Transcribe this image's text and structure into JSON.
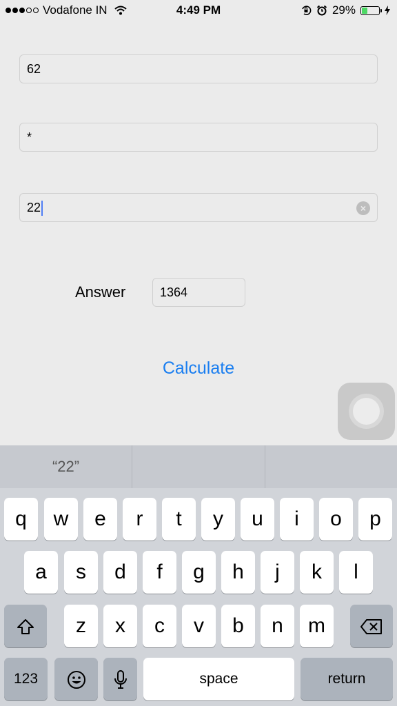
{
  "status_bar": {
    "carrier": "Vodafone IN",
    "time": "4:49 PM",
    "battery_percent": "29%",
    "battery_level": 0.29,
    "signal_bars_filled": 3,
    "signal_bars_total": 5,
    "icons": [
      "wifi-icon",
      "orientation-lock-icon",
      "alarm-icon",
      "battery-icon",
      "charging-bolt-icon"
    ],
    "battery_color": "#4cd964"
  },
  "form": {
    "first_operand": "62",
    "operator": "*",
    "second_operand": "22",
    "answer_label": "Answer",
    "answer_value": "1364",
    "calculate_label": "Calculate",
    "accent_color": "#1a7ef0"
  },
  "keyboard": {
    "suggestions": [
      "“22”",
      "",
      ""
    ],
    "rows": [
      [
        "q",
        "w",
        "e",
        "r",
        "t",
        "y",
        "u",
        "i",
        "o",
        "p"
      ],
      [
        "a",
        "s",
        "d",
        "f",
        "g",
        "h",
        "j",
        "k",
        "l"
      ],
      [
        "z",
        "x",
        "c",
        "v",
        "b",
        "n",
        "m"
      ]
    ],
    "numbers_key": "123",
    "space_key": "space",
    "return_key": "return",
    "icons": [
      "shift-icon",
      "backspace-icon",
      "emoji-icon",
      "microphone-icon"
    ]
  }
}
